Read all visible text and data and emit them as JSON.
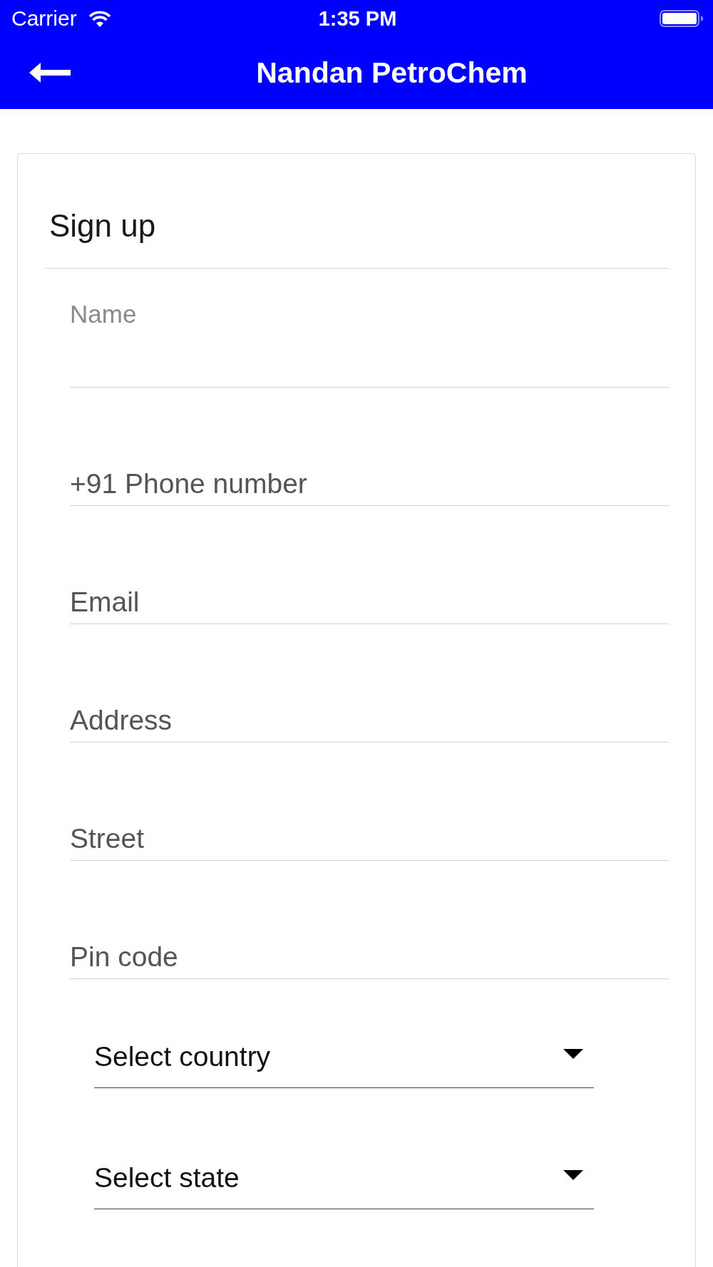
{
  "status_bar": {
    "carrier": "Carrier",
    "time": "1:35 PM"
  },
  "nav_bar": {
    "title": "Nandan PetroChem"
  },
  "form": {
    "title": "Sign up",
    "fields": [
      {
        "kind": "floating",
        "label": "Name"
      },
      {
        "kind": "plain",
        "placeholder": "+91 Phone number"
      },
      {
        "kind": "plain",
        "placeholder": "Email"
      },
      {
        "kind": "plain",
        "placeholder": "Address"
      },
      {
        "kind": "plain",
        "placeholder": "Street"
      },
      {
        "kind": "plain",
        "placeholder": "Pin code"
      }
    ],
    "dropdowns": [
      {
        "prompt": "Select country"
      },
      {
        "prompt": "Select state"
      }
    ]
  }
}
